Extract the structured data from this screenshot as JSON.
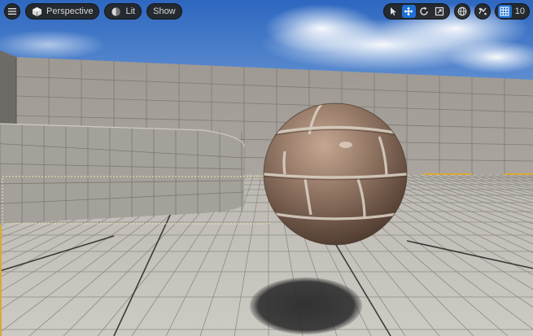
{
  "toolbar": {
    "menu_icon": "hamburger-menu-icon",
    "view_mode_label": "Perspective",
    "view_mode_icon": "perspective-cube-icon",
    "lit_label": "Lit",
    "lit_icon": "lit-sphere-icon",
    "show_label": "Show"
  },
  "transform_tools": {
    "select_icon": "select-arrow-icon",
    "translate_icon": "translate-arrows-icon",
    "rotate_icon": "rotate-icon",
    "scale_icon": "scale-icon",
    "active_tool": "translate"
  },
  "snapping": {
    "world_local_icon": "globe-icon",
    "surface_snap_icon": "surface-snap-icon",
    "grid_snap_icon": "grid-snap-icon",
    "grid_snap_value": "10"
  },
  "colors": {
    "accent": "#1f6fd6",
    "toolbar_bg": "#242424",
    "sky_top": "#2f6ac0",
    "sky_bottom": "#a9c3e6",
    "floor": "#c9c6c0",
    "wall": "#a9a49e",
    "sphere": "#8f7260",
    "selection_outline": "#f0c040"
  }
}
